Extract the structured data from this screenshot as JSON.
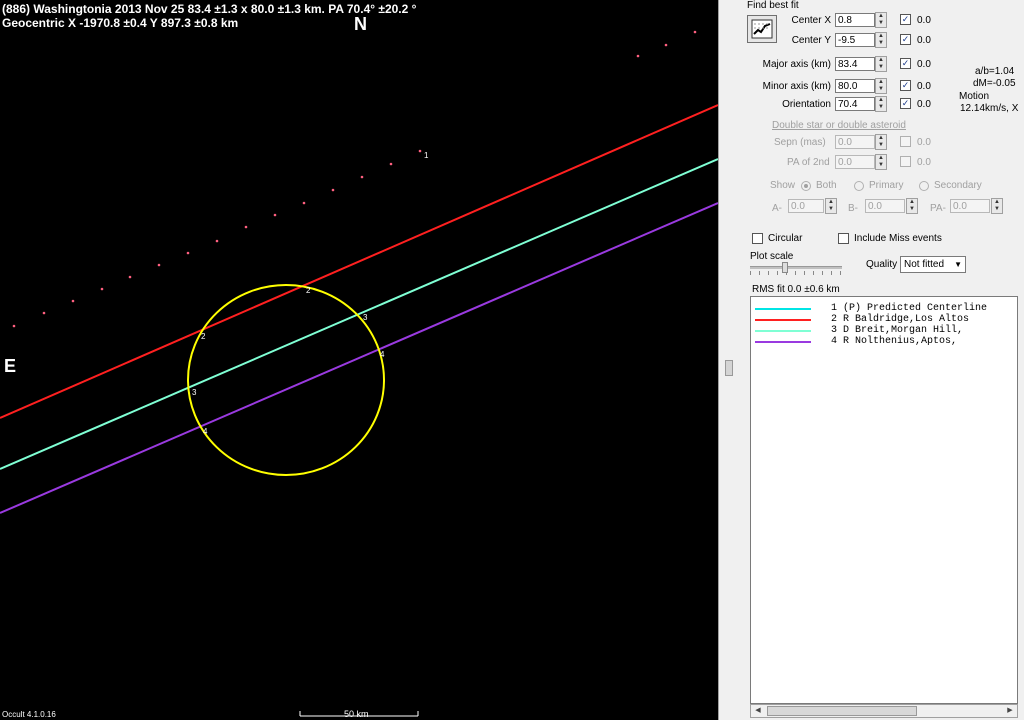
{
  "header": {
    "line1": "(886) Washingtonia  2013 Nov 25   83.4 ±1.3 x 80.0 ±1.3 km.  PA 70.4° ±20.2 °",
    "line2": "Geocentric X  -1970.8 ±0.4  Y 897.3 ±0.8 km"
  },
  "directions": {
    "north": "N",
    "east": "E"
  },
  "version": "Occult 4.1.0.16",
  "scale_bar_label": "50 km",
  "chord_labels": [
    "1",
    "2",
    "2",
    "3",
    "3",
    "4",
    "4"
  ],
  "colors": {
    "ellipse": "#ffff00",
    "chord_1": "#00e5e5",
    "chord_2": "#ff2020",
    "chord_3": "#7fffd4",
    "chord_4": "#9a3ae0",
    "dots": "#ff6080"
  },
  "panel": {
    "find_best_fit_label": "Find best fit",
    "fields": [
      {
        "label": "Center X",
        "value": "0.8",
        "check_value": "0.0",
        "checked": true
      },
      {
        "label": "Center Y",
        "value": "-9.5",
        "check_value": "0.0",
        "checked": true
      },
      {
        "label": "Major axis (km)",
        "value": "83.4",
        "check_value": "0.0",
        "checked": true
      },
      {
        "label": "Minor axis (km)",
        "value": "80.0",
        "check_value": "0.0",
        "checked": true
      },
      {
        "label": "Orientation",
        "value": "70.4",
        "check_value": "0.0",
        "checked": true
      }
    ],
    "stats": {
      "ab": "a/b=1.04",
      "dm": "dM=-0.05",
      "motion_label": "Motion",
      "motion_value": "12.14km/s, X"
    },
    "double_star_label": "Double star or double asteroid",
    "sepn_label": "Sepn (mas)",
    "sepn_value": "0.0",
    "sepn_check": "0.0",
    "pa2_label": "PA of 2nd",
    "pa2_value": "0.0",
    "pa2_check": "0.0",
    "show_label": "Show",
    "show_options": [
      "Both",
      "Primary",
      "Secondary"
    ],
    "a_label": "A-",
    "a_value": "0.0",
    "b_label": "B-",
    "b_value": "0.0",
    "pa_label": "PA-",
    "pa_value": "0.0",
    "circular_label": "Circular",
    "include_miss_label": "Include Miss events",
    "plot_scale_label": "Plot scale",
    "quality_label": "Quality",
    "quality_value": "Not fitted",
    "rms_label": "RMS fit 0.0 ±0.6 km"
  },
  "legend": [
    {
      "num": "1",
      "text": "(P)  Predicted Centerline",
      "color": "#00e5e5"
    },
    {
      "num": "2",
      "text": "     R Baldridge,Los Altos",
      "color": "#ff2020"
    },
    {
      "num": "3",
      "text": "     D Breit,Morgan Hill,",
      "color": "#7fffd4"
    },
    {
      "num": "4",
      "text": "     R Nolthenius,Aptos,",
      "color": "#9a3ae0"
    }
  ]
}
